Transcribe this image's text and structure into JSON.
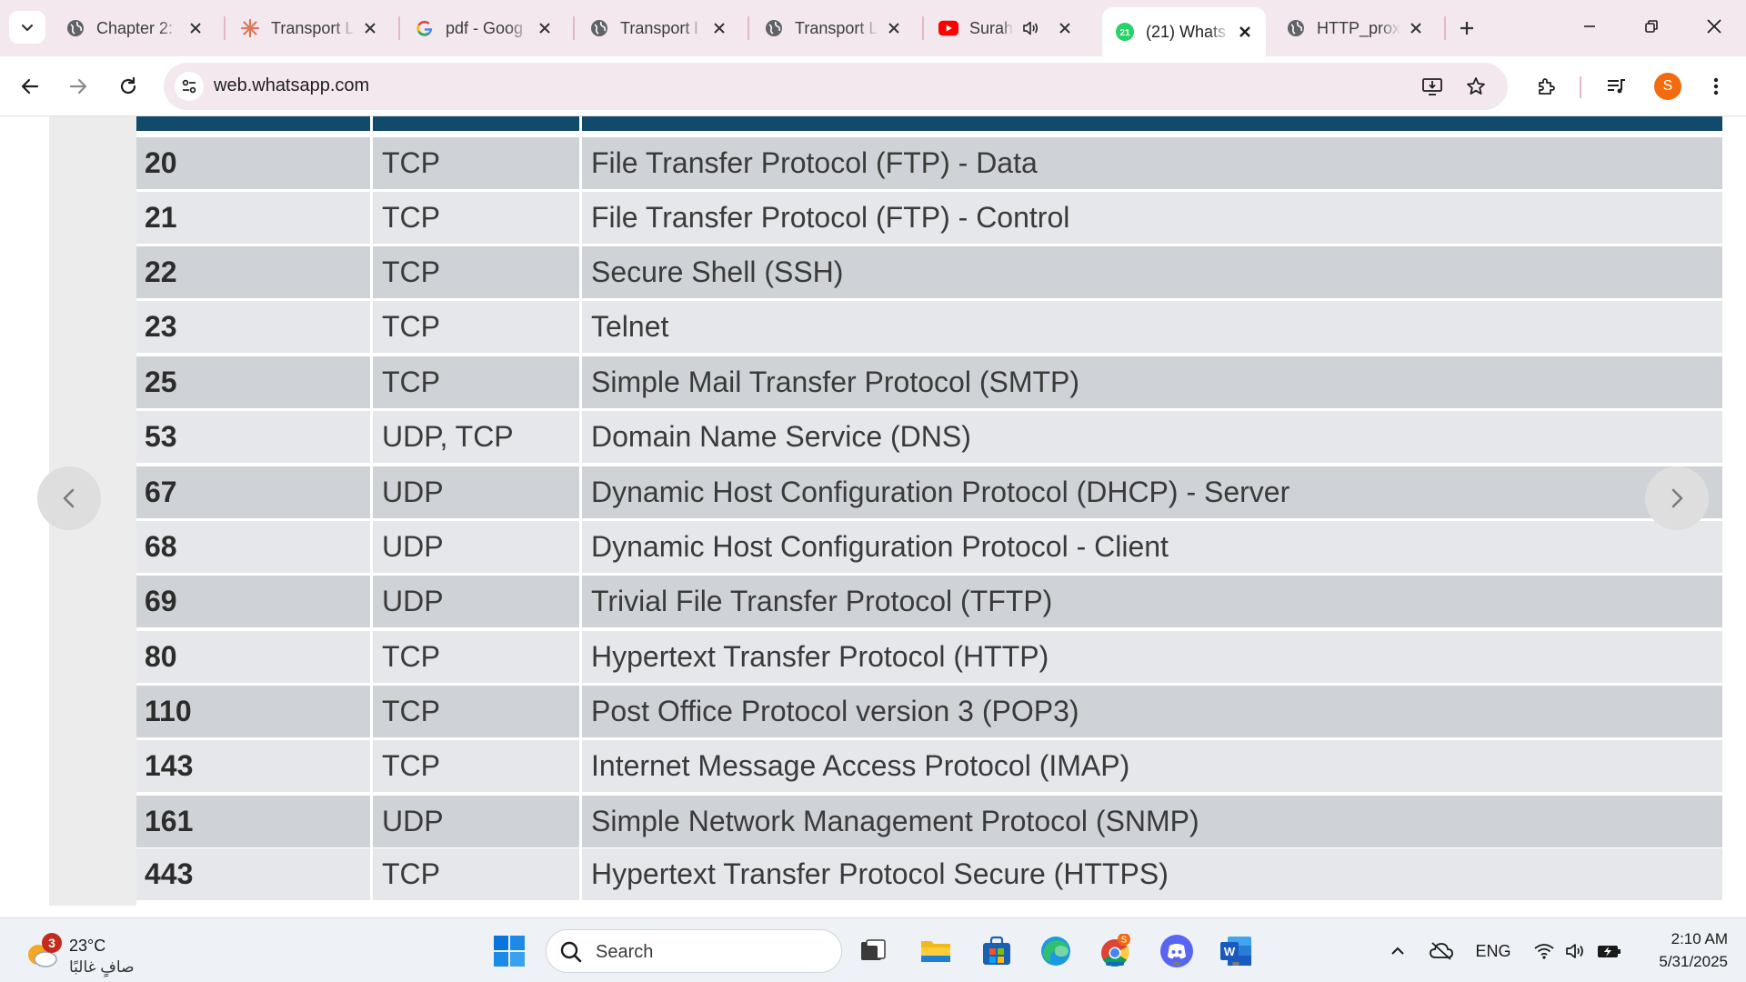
{
  "browser": {
    "tabs": [
      {
        "title": "Chapter 2:",
        "favicon": "globe-icon"
      },
      {
        "title": "Transport L",
        "favicon": "claude-icon"
      },
      {
        "title": "pdf - Goog",
        "favicon": "google-icon"
      },
      {
        "title": "Transport l",
        "favicon": "globe-icon"
      },
      {
        "title": "Transport L",
        "favicon": "globe-icon"
      },
      {
        "title": "Surah A",
        "favicon": "youtube-icon",
        "audio": true
      },
      {
        "title": "(21) Whats",
        "favicon": "whatsapp-icon",
        "active": true,
        "badge": "21"
      },
      {
        "title": "HTTP_prox",
        "favicon": "globe-icon"
      }
    ],
    "url": "web.whatsapp.com",
    "profile_initial": "S"
  },
  "table": {
    "rows": [
      {
        "port": "20",
        "protocol": "TCP",
        "application": "File Transfer Protocol (FTP) - Data"
      },
      {
        "port": "21",
        "protocol": "TCP",
        "application": "File Transfer Protocol (FTP) - Control"
      },
      {
        "port": "22",
        "protocol": "TCP",
        "application": "Secure Shell (SSH)"
      },
      {
        "port": "23",
        "protocol": "TCP",
        "application": "Telnet"
      },
      {
        "port": "25",
        "protocol": "TCP",
        "application": "Simple Mail Transfer Protocol (SMTP)"
      },
      {
        "port": "53",
        "protocol": "UDP, TCP",
        "application": "Domain Name Service (DNS)"
      },
      {
        "port": "67",
        "protocol": "UDP",
        "application": "Dynamic Host Configuration Protocol (DHCP) - Server"
      },
      {
        "port": "68",
        "protocol": "UDP",
        "application": "Dynamic Host Configuration Protocol - Client"
      },
      {
        "port": "69",
        "protocol": "UDP",
        "application": "Trivial File Transfer Protocol (TFTP)"
      },
      {
        "port": "80",
        "protocol": "TCP",
        "application": "Hypertext Transfer Protocol (HTTP)"
      },
      {
        "port": "110",
        "protocol": "TCP",
        "application": "Post Office Protocol version 3 (POP3)"
      },
      {
        "port": "143",
        "protocol": "TCP",
        "application": "Internet Message Access Protocol (IMAP)"
      },
      {
        "port": "161",
        "protocol": "UDP",
        "application": "Simple Network Management Protocol (SNMP)"
      },
      {
        "port": "443",
        "protocol": "TCP",
        "application": "Hypertext Transfer Protocol Secure (HTTPS)"
      }
    ],
    "colors": {
      "header": "#114a6a",
      "row_dark": "#cfd2d6",
      "row_light": "#e6e7ea"
    }
  },
  "taskbar": {
    "weather": {
      "badge": "3",
      "temperature": "23°C",
      "condition": "صافٍ غالبًا"
    },
    "search_placeholder": "Search",
    "chrome_badge": "S",
    "language": "ENG",
    "time": "2:10 AM",
    "date": "5/31/2025"
  }
}
